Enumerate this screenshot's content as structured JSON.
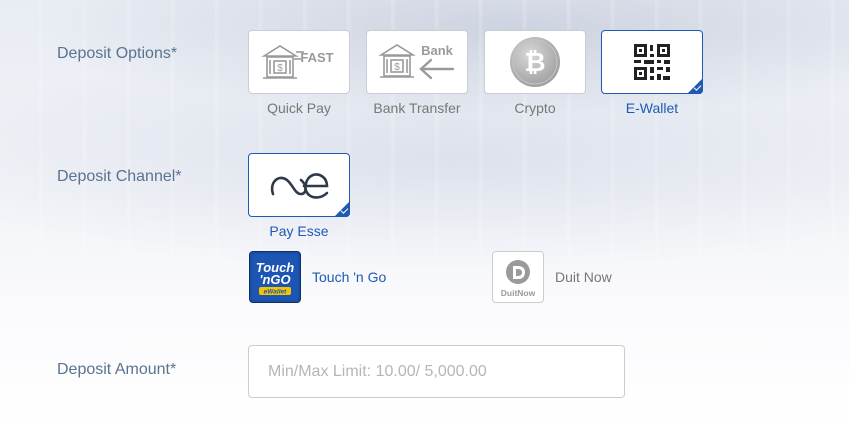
{
  "deposit_options": {
    "label": "Deposit Options*",
    "items": [
      {
        "label": "Quick Pay",
        "icon": "fast-bank-icon",
        "fast_text": "FAST"
      },
      {
        "label": "Bank Transfer",
        "icon": "bank-transfer-icon",
        "bank_text": "Bank"
      },
      {
        "label": "Crypto",
        "icon": "bitcoin-icon"
      },
      {
        "label": "E-Wallet",
        "icon": "qr-code-icon"
      }
    ],
    "selected": "E-Wallet"
  },
  "deposit_channel": {
    "label": "Deposit Channel*",
    "selected_channel": {
      "label": "Pay Esse",
      "icon": "payesse-logo-icon"
    },
    "sub_channels": [
      {
        "label": "Touch 'n Go",
        "icon": "touch-n-go-icon",
        "logo_line1": "Touch",
        "logo_line2": "'nGO",
        "logo_line3": "eWallet"
      },
      {
        "label": "Duit Now",
        "icon": "duitnow-icon",
        "logo_text": "DuitNow"
      }
    ]
  },
  "deposit_amount": {
    "label": "Deposit Amount*",
    "placeholder": "Min/Max Limit: 10.00/ 5,000.00",
    "value": ""
  },
  "colors": {
    "accent": "#1e5ab4",
    "label": "#5a7390",
    "border": "#c9cdd3",
    "muted_text": "#777777"
  }
}
